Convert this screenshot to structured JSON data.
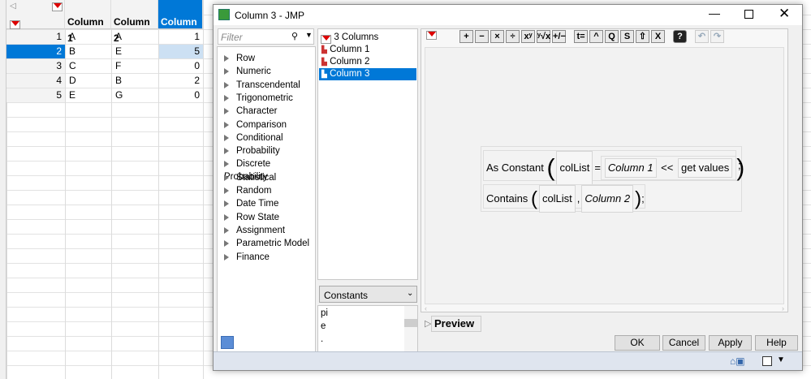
{
  "table": {
    "columns": [
      "Column 1",
      "Column 2",
      "Column 3"
    ],
    "rows": [
      {
        "n": "1",
        "c1": "A",
        "c2": "A",
        "c3": "1"
      },
      {
        "n": "2",
        "c1": "B",
        "c2": "E",
        "c3": "5"
      },
      {
        "n": "3",
        "c1": "C",
        "c2": "F",
        "c3": "0"
      },
      {
        "n": "4",
        "c1": "D",
        "c2": "B",
        "c3": "2"
      },
      {
        "n": "5",
        "c1": "E",
        "c2": "G",
        "c3": "0"
      }
    ],
    "selected_row": "2",
    "selected_column": "Column 3"
  },
  "dialog": {
    "title": "Column 3 - JMP",
    "filter_placeholder": "Filter",
    "function_groups": [
      "Row",
      "Numeric",
      "Transcendental",
      "Trigonometric",
      "Character",
      "Comparison",
      "Conditional",
      "Probability",
      "Discrete Probability",
      "Statistical",
      "Random",
      "Date Time",
      "Row State",
      "Assignment",
      "Parametric Model",
      "Finance"
    ],
    "columns_header": "3 Columns",
    "columns": [
      "Column 1",
      "Column 2",
      "Column 3"
    ],
    "constants_dropdown": "Constants",
    "constants": [
      "pi",
      "e",
      "."
    ],
    "formula": {
      "line1_fn": "As Constant",
      "var": "colList",
      "eq": "=",
      "col1": "Column 1",
      "op": "<<",
      "msg": "get values",
      "semi": ";",
      "line2_fn": "Contains",
      "comma": ",",
      "col2": "Column 2"
    },
    "toolbar": [
      "+",
      "−",
      "×",
      "÷",
      "xʸ",
      "ʸ√x",
      "+/−",
      "t=",
      "^",
      "Q",
      "S",
      "⇧",
      "X",
      "?",
      "↶",
      "↷"
    ],
    "preview_label": "Preview",
    "buttons": {
      "ok": "OK",
      "cancel": "Cancel",
      "apply": "Apply",
      "help": "Help"
    },
    "accent": "#0078d7"
  }
}
